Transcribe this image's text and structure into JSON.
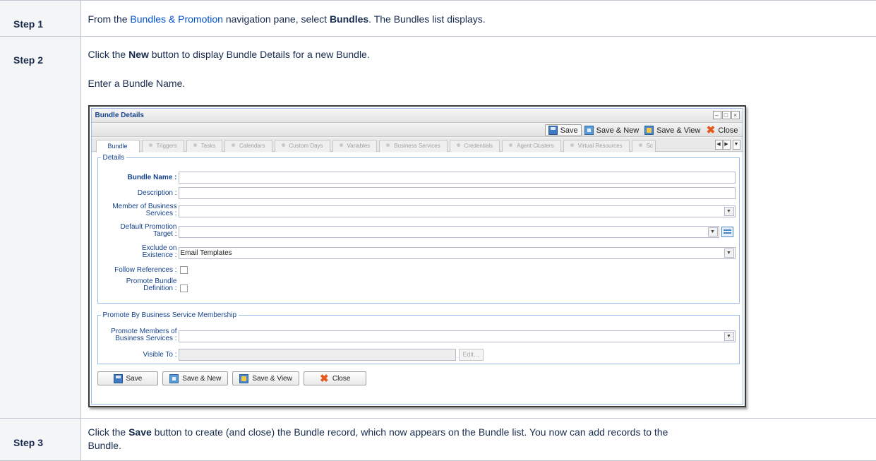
{
  "steps": [
    {
      "label": "Step 1",
      "text_pre": "From the ",
      "link": "Bundles & Promotion",
      "text_mid": " navigation pane, select ",
      "bold": "Bundles",
      "text_post": ". The Bundles list displays."
    },
    {
      "label": "Step 2",
      "text_pre": "Click the ",
      "bold": "New",
      "text_post": " button to display Bundle Details for a new Bundle.",
      "second_line": "Enter a Bundle Name."
    },
    {
      "label": "Step 3",
      "text_pre": "Click the ",
      "bold": "Save",
      "text_post": " button to create (and close) the Bundle record, which now appears on the Bundle list. You now can add records to the",
      "second_line": "Bundle."
    }
  ],
  "window": {
    "title": "Bundle Details",
    "toolbar": {
      "save": "Save",
      "save_new": "Save & New",
      "save_view": "Save & View",
      "close": "Close"
    },
    "tabs": [
      "Bundle",
      "Triggers",
      "Tasks",
      "Calendars",
      "Custom Days",
      "Variables",
      "Business Services",
      "Credentials",
      "Agent Clusters",
      "Virtual Resources",
      "Sc"
    ],
    "details": {
      "legend": "Details",
      "bundle_name_label": "Bundle Name :",
      "description_label": "Description :",
      "member_label_1": "Member of Business",
      "member_label_2": "Services :",
      "promotion_label_1": "Default Promotion",
      "promotion_label_2": "Target :",
      "exclude_label_1": "Exclude on",
      "exclude_label_2": "Existence :",
      "exclude_value": "Email Templates",
      "follow_label": "Follow References :",
      "promote_label_1": "Promote Bundle",
      "promote_label_2": "Definition :"
    },
    "membership": {
      "legend": "Promote By Business Service Membership",
      "members_label_1": "Promote Members of",
      "members_label_2": "Business Services :",
      "visible_label": "Visible To :",
      "edit_button": "Edit..."
    },
    "buttons": {
      "save": "Save",
      "save_new": "Save & New",
      "save_view": "Save & View",
      "close": "Close"
    }
  }
}
